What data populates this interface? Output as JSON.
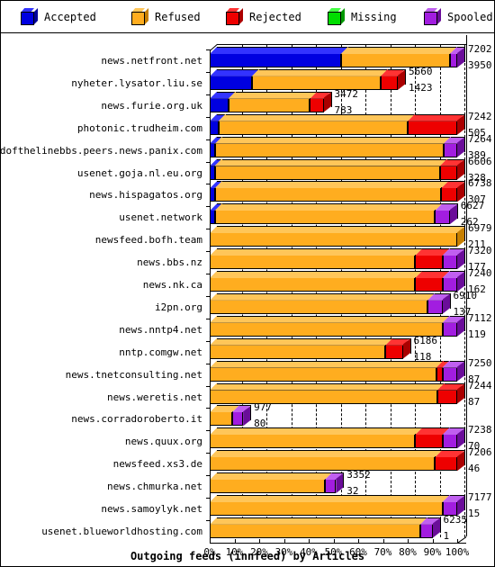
{
  "legend": {
    "items": [
      {
        "label": "Accepted",
        "color": "#0000e0",
        "top": "#3333ff",
        "side": "#000099",
        "key": "accepted"
      },
      {
        "label": "Refused",
        "color": "#ffad1f",
        "top": "#ffc659",
        "side": "#c67f00",
        "key": "refused"
      },
      {
        "label": "Rejected",
        "color": "#ee0000",
        "top": "#ff3333",
        "side": "#aa0000",
        "key": "rejected"
      },
      {
        "label": "Missing",
        "color": "#00dd00",
        "top": "#44ff44",
        "side": "#009900",
        "key": "missing"
      },
      {
        "label": "Spooled",
        "color": "#a21de0",
        "top": "#c060f0",
        "side": "#6a0d99",
        "key": "spooled"
      }
    ]
  },
  "chart_data": {
    "type": "bar",
    "orientation": "horizontal",
    "stacked": true,
    "title": "Outgoing feeds (innfeed) by Articles",
    "xlabel": "",
    "ylabel": "",
    "xlim": [
      0,
      100
    ],
    "xunit": "%",
    "grid": true,
    "legend_position": "top",
    "xticks": [
      "0%",
      "10%",
      "20%",
      "30%",
      "40%",
      "50%",
      "60%",
      "70%",
      "80%",
      "90%",
      "100%"
    ],
    "xtick_values": [
      0,
      10,
      20,
      30,
      40,
      50,
      60,
      70,
      80,
      90,
      100
    ],
    "series_names": [
      "Accepted",
      "Refused",
      "Rejected",
      "Missing",
      "Spooled"
    ],
    "categories": [
      "news.netfront.net",
      "nyheter.lysator.liu.se",
      "news.furie.org.uk",
      "photonic.trudheim.com",
      "endofthelinebbs.peers.news.panix.com",
      "usenet.goja.nl.eu.org",
      "news.hispagatos.org",
      "usenet.network",
      "newsfeed.bofh.team",
      "news.bbs.nz",
      "news.nk.ca",
      "i2pn.org",
      "news.nntp4.net",
      "nntp.comgw.net",
      "news.tnetconsulting.net",
      "news.weretis.net",
      "news.corradoroberto.it",
      "news.quux.org",
      "newsfeed.xs3.de",
      "news.chmurka.net",
      "news.samoylyk.net",
      "usenet.blueworldhosting.com"
    ],
    "rows": [
      {
        "category": "news.netfront.net",
        "label_top": "7202",
        "label_bottom": "3950",
        "total_pct": 100.0,
        "segments": [
          {
            "key": "accepted",
            "pct": 53.0
          },
          {
            "key": "refused",
            "pct": 44.0
          },
          {
            "key": "spooled",
            "pct": 3.0
          }
        ]
      },
      {
        "category": "nyheter.lysator.liu.se",
        "label_top": "5660",
        "label_bottom": "1423",
        "total_pct": 76.0,
        "segments": [
          {
            "key": "accepted",
            "pct": 17.0
          },
          {
            "key": "refused",
            "pct": 52.0
          },
          {
            "key": "rejected",
            "pct": 7.0
          }
        ]
      },
      {
        "category": "news.furie.org.uk",
        "label_top": "3472",
        "label_bottom": "783",
        "total_pct": 46.0,
        "segments": [
          {
            "key": "accepted",
            "pct": 7.5
          },
          {
            "key": "refused",
            "pct": 33.0
          },
          {
            "key": "rejected",
            "pct": 5.5
          }
        ]
      },
      {
        "category": "photonic.trudheim.com",
        "label_top": "7242",
        "label_bottom": "505",
        "total_pct": 100.0,
        "segments": [
          {
            "key": "accepted",
            "pct": 3.5
          },
          {
            "key": "refused",
            "pct": 76.5
          },
          {
            "key": "rejected",
            "pct": 20.0
          }
        ]
      },
      {
        "category": "endofthelinebbs.peers.news.panix.com",
        "label_top": "7264",
        "label_bottom": "389",
        "total_pct": 100.0,
        "segments": [
          {
            "key": "accepted",
            "pct": 2.2
          },
          {
            "key": "refused",
            "pct": 92.3
          },
          {
            "key": "spooled",
            "pct": 5.5
          }
        ]
      },
      {
        "category": "usenet.goja.nl.eu.org",
        "label_top": "6606",
        "label_bottom": "328",
        "total_pct": 100.0,
        "segments": [
          {
            "key": "accepted",
            "pct": 2.0
          },
          {
            "key": "refused",
            "pct": 91.0
          },
          {
            "key": "rejected",
            "pct": 7.0
          }
        ]
      },
      {
        "category": "news.hispagatos.org",
        "label_top": "6738",
        "label_bottom": "307",
        "total_pct": 100.0,
        "segments": [
          {
            "key": "accepted",
            "pct": 2.0
          },
          {
            "key": "refused",
            "pct": 91.5
          },
          {
            "key": "rejected",
            "pct": 6.5
          }
        ]
      },
      {
        "category": "usenet.network",
        "label_top": "6627",
        "label_bottom": "262",
        "total_pct": 97.0,
        "segments": [
          {
            "key": "accepted",
            "pct": 2.0
          },
          {
            "key": "refused",
            "pct": 89.0
          },
          {
            "key": "spooled",
            "pct": 6.0
          }
        ]
      },
      {
        "category": "newsfeed.bofh.team",
        "label_top": "6979",
        "label_bottom": "211",
        "total_pct": 100.0,
        "segments": [
          {
            "key": "refused",
            "pct": 100.0
          }
        ]
      },
      {
        "category": "news.bbs.nz",
        "label_top": "7320",
        "label_bottom": "177",
        "total_pct": 100.0,
        "segments": [
          {
            "key": "refused",
            "pct": 83.0
          },
          {
            "key": "rejected",
            "pct": 11.0
          },
          {
            "key": "spooled",
            "pct": 6.0
          }
        ]
      },
      {
        "category": "news.nk.ca",
        "label_top": "7240",
        "label_bottom": "162",
        "total_pct": 100.0,
        "segments": [
          {
            "key": "refused",
            "pct": 83.0
          },
          {
            "key": "rejected",
            "pct": 11.0
          },
          {
            "key": "spooled",
            "pct": 6.0
          }
        ]
      },
      {
        "category": "i2pn.org",
        "label_top": "6910",
        "label_bottom": "137",
        "total_pct": 94.0,
        "segments": [
          {
            "key": "refused",
            "pct": 88.0
          },
          {
            "key": "spooled",
            "pct": 6.0
          }
        ]
      },
      {
        "category": "news.nntp4.net",
        "label_top": "7112",
        "label_bottom": "119",
        "total_pct": 100.0,
        "segments": [
          {
            "key": "refused",
            "pct": 94.0
          },
          {
            "key": "spooled",
            "pct": 6.0
          }
        ]
      },
      {
        "category": "nntp.comgw.net",
        "label_top": "6186",
        "label_bottom": "118",
        "total_pct": 78.0,
        "segments": [
          {
            "key": "refused",
            "pct": 71.0
          },
          {
            "key": "rejected",
            "pct": 7.0
          }
        ]
      },
      {
        "category": "news.tnetconsulting.net",
        "label_top": "7250",
        "label_bottom": "87",
        "total_pct": 100.0,
        "segments": [
          {
            "key": "refused",
            "pct": 91.5
          },
          {
            "key": "rejected",
            "pct": 2.5
          },
          {
            "key": "spooled",
            "pct": 6.0
          }
        ]
      },
      {
        "category": "news.weretis.net",
        "label_top": "7244",
        "label_bottom": "87",
        "total_pct": 100.0,
        "segments": [
          {
            "key": "refused",
            "pct": 92.0
          },
          {
            "key": "rejected",
            "pct": 8.0
          }
        ]
      },
      {
        "category": "news.corradoroberto.it",
        "label_top": "977",
        "label_bottom": "80",
        "total_pct": 13.5,
        "segments": [
          {
            "key": "refused",
            "pct": 9.0
          },
          {
            "key": "spooled",
            "pct": 4.5
          }
        ]
      },
      {
        "category": "news.quux.org",
        "label_top": "7238",
        "label_bottom": "70",
        "total_pct": 100.0,
        "segments": [
          {
            "key": "refused",
            "pct": 83.0
          },
          {
            "key": "rejected",
            "pct": 11.0
          },
          {
            "key": "spooled",
            "pct": 6.0
          }
        ]
      },
      {
        "category": "newsfeed.xs3.de",
        "label_top": "7206",
        "label_bottom": "46",
        "total_pct": 100.0,
        "segments": [
          {
            "key": "refused",
            "pct": 91.0
          },
          {
            "key": "rejected",
            "pct": 9.0
          }
        ]
      },
      {
        "category": "news.chmurka.net",
        "label_top": "3352",
        "label_bottom": "32",
        "total_pct": 51.0,
        "segments": [
          {
            "key": "refused",
            "pct": 46.5
          },
          {
            "key": "spooled",
            "pct": 4.5
          }
        ]
      },
      {
        "category": "news.samoylyk.net",
        "label_top": "7177",
        "label_bottom": "15",
        "total_pct": 100.0,
        "segments": [
          {
            "key": "refused",
            "pct": 94.0
          },
          {
            "key": "spooled",
            "pct": 6.0
          }
        ]
      },
      {
        "category": "usenet.blueworldhosting.com",
        "label_top": "6235",
        "label_bottom": "1",
        "total_pct": 90.0,
        "segments": [
          {
            "key": "refused",
            "pct": 85.0
          },
          {
            "key": "spooled",
            "pct": 5.0
          }
        ]
      }
    ]
  }
}
